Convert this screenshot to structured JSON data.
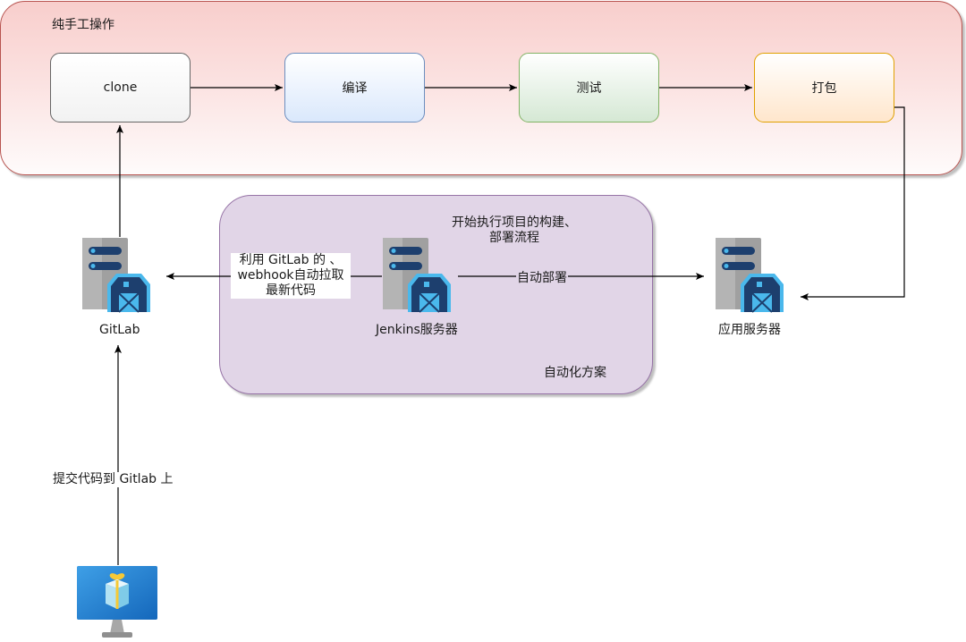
{
  "regions": {
    "manual": {
      "title": "纯手工操作"
    },
    "auto": {
      "title": "自动化方案"
    }
  },
  "steps": [
    {
      "id": "clone",
      "label": "clone"
    },
    {
      "id": "compile",
      "label": "编译"
    },
    {
      "id": "test",
      "label": "测试"
    },
    {
      "id": "package",
      "label": "打包"
    }
  ],
  "nodes": {
    "gitlab": {
      "label": "GitLab",
      "icon": "server-barn-icon"
    },
    "jenkins": {
      "label": "Jenkins服务器",
      "icon": "server-barn-icon"
    },
    "app_server": {
      "label": "应用服务器",
      "icon": "server-barn-icon"
    },
    "developer": {
      "icon": "monitor-gift-icon"
    }
  },
  "edge_labels": {
    "webhook": "利用 GitLab 的 、webhook自动拉取最新代码",
    "deploy": "自动部署",
    "commit": "提交代码到 Gitlab 上",
    "jenkins_flow": "开始执行项目的构建、部署流程"
  },
  "colors": {
    "manual_fill": "#f8cecc",
    "manual_stroke": "#b85450",
    "auto_fill": "#e1d5e7",
    "auto_stroke": "#9673a6",
    "server_gray": "#9b9b9b",
    "server_bar": "#1d3f6e",
    "barn_blue": "#4ab8ec"
  }
}
